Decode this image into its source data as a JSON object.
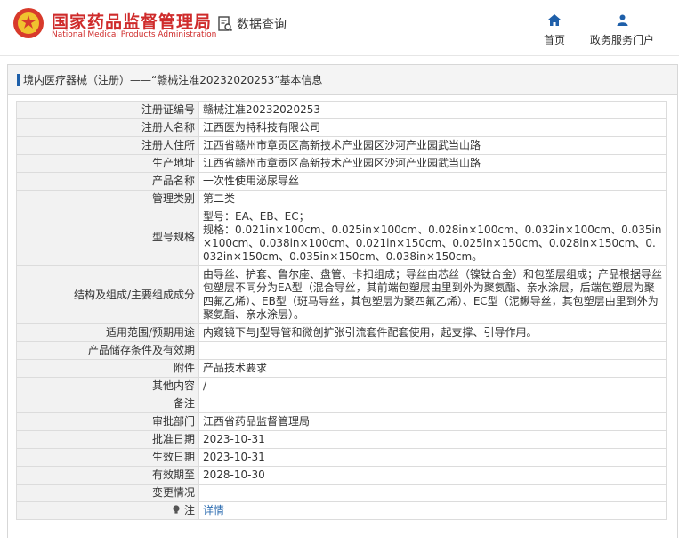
{
  "header": {
    "org_name": "国家药品监督管理局",
    "org_name_en": "National Medical Products Administration",
    "query_label": "数据查询",
    "nav": [
      {
        "label": "首页",
        "icon": "home-icon"
      },
      {
        "label": "政务服务门户",
        "icon": "user-icon"
      }
    ],
    "colors": {
      "brand": "#cf2b2b",
      "nav": "#1e5fa9"
    }
  },
  "panel": {
    "title": "境内医疗器械（注册）——“赣械注准20232020253”基本信息"
  },
  "rows": [
    {
      "label": "注册证编号",
      "value": "赣械注准20232020253"
    },
    {
      "label": "注册人名称",
      "value": "江西医为特科技有限公司"
    },
    {
      "label": "注册人住所",
      "value": "江西省赣州市章贡区高新技术产业园区沙河产业园武当山路"
    },
    {
      "label": "生产地址",
      "value": "江西省赣州市章贡区高新技术产业园区沙河产业园武当山路"
    },
    {
      "label": "产品名称",
      "value": "一次性使用泌尿导丝"
    },
    {
      "label": "管理类别",
      "value": "第二类"
    },
    {
      "label": "型号规格",
      "value_lines": [
        "型号：EA、EB、EC；",
        "规格：0.021in×100cm、0.025in×100cm、0.028in×100cm、0.032in×100cm、0.035in×100cm、0.038in×100cm、0.021in×150cm、0.025in×150cm、0.028in×150cm、0.032in×150cm、0.035in×150cm、0.038in×150cm。"
      ]
    },
    {
      "label": "结构及组成/主要组成成分",
      "value": "由导丝、护套、鲁尔座、盘管、卡扣组成；导丝由芯丝（镍钛合金）和包塑层组成；产品根据导丝包塑层不同分为EA型（混合导丝，其前端包塑层由里到外为聚氨酯、亲水涂层，后端包塑层为聚四氟乙烯）、EB型（斑马导丝，其包塑层为聚四氟乙烯）、EC型（泥鳅导丝，其包塑层由里到外为聚氨酯、亲水涂层）。"
    },
    {
      "label": "适用范围/预期用途",
      "value": "内窥镜下与J型导管和微创扩张引流套件配套使用，起支撑、引导作用。"
    },
    {
      "label": "产品储存条件及有效期",
      "value": ""
    },
    {
      "label": "附件",
      "value": "产品技术要求"
    },
    {
      "label": "其他内容",
      "value": "/"
    },
    {
      "label": "备注",
      "value": ""
    },
    {
      "label": "审批部门",
      "value": "江西省药品监督管理局"
    },
    {
      "label": "批准日期",
      "value": "2023-10-31"
    },
    {
      "label": "生效日期",
      "value": "2023-10-31"
    },
    {
      "label": "有效期至",
      "value": "2028-10-30"
    },
    {
      "label": "变更情况",
      "value": ""
    },
    {
      "label": "注",
      "icon": "lightbulb-icon",
      "link": "详情"
    }
  ]
}
